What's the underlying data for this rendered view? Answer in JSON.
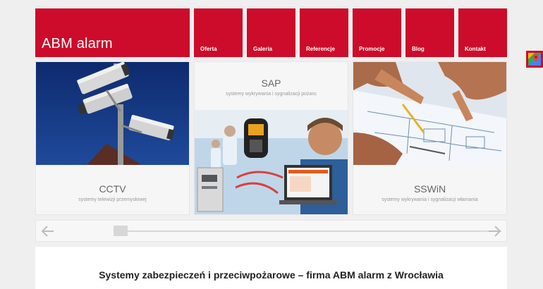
{
  "header": {
    "logo": "ABM alarm"
  },
  "nav": [
    {
      "label": "Oferta"
    },
    {
      "label": "Galeria"
    },
    {
      "label": "Referencje"
    },
    {
      "label": "Promocje"
    },
    {
      "label": "Blog"
    },
    {
      "label": "Kontakt"
    }
  ],
  "maps_button": {
    "icon": "google-maps-icon"
  },
  "cards": [
    {
      "title": "CCTV",
      "subtitle": "systemy telewizji przemysłowej"
    },
    {
      "title": "SAP",
      "subtitle": "systemy wykrywania i sygnalizacji pożaru"
    },
    {
      "title": "SSWiN",
      "subtitle": "systemy wykrywania i sygnalizacji włamania"
    }
  ],
  "slider": {
    "prev_icon": "arrow-left-icon",
    "next_icon": "arrow-right-icon"
  },
  "content": {
    "heading": "Systemy zabezpieczeń i przeciwpożarowe – firma ABM alarm z Wrocławia"
  },
  "colors": {
    "brand": "#cc0c2a",
    "background": "#efefef"
  }
}
